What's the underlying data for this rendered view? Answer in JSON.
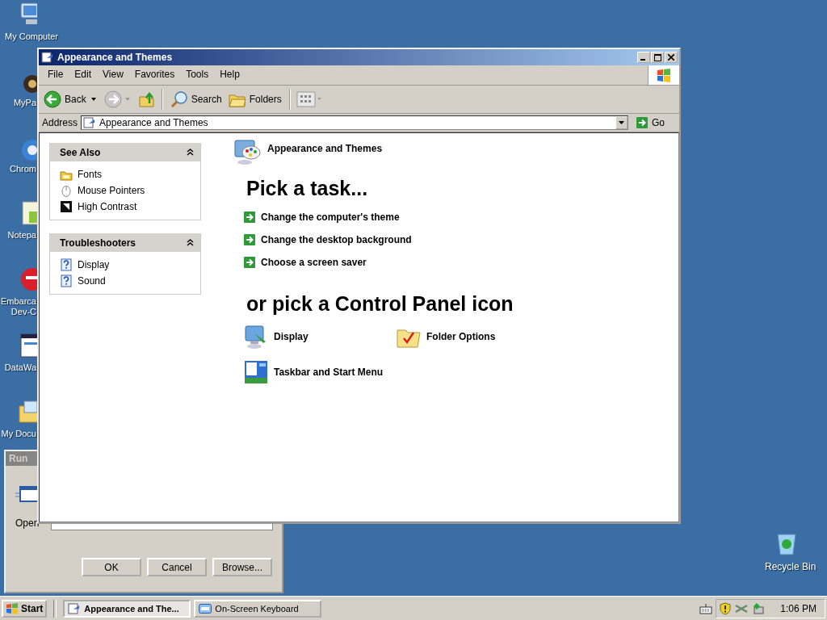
{
  "desktop_icons": [
    {
      "kind": "computer",
      "lines": [
        "My Computer"
      ]
    },
    {
      "kind": "app",
      "lines": [
        "MyPa"
      ]
    },
    {
      "kind": "browser",
      "lines": [
        "Chrom"
      ]
    },
    {
      "kind": "notepad",
      "lines": [
        "Notepa"
      ]
    },
    {
      "kind": "dev",
      "lines": [
        "Embarca",
        "Dev-C"
      ]
    },
    {
      "kind": "window",
      "lines": [
        "DataWa"
      ]
    },
    {
      "kind": "documents",
      "lines": [
        "My Docu"
      ]
    }
  ],
  "recycle_bin": {
    "label": "Recycle Bin"
  },
  "run_dialog": {
    "title": "Run",
    "open_label": "Open",
    "buttons": [
      "OK",
      "Cancel",
      "Browse..."
    ]
  },
  "window": {
    "title": "Appearance and Themes",
    "menu": [
      "File",
      "Edit",
      "View",
      "Favorites",
      "Tools",
      "Help"
    ],
    "toolbar": {
      "back": "Back",
      "search": "Search",
      "folders": "Folders"
    },
    "address": {
      "label": "Address",
      "value": "Appearance and Themes",
      "go": "Go"
    },
    "sidebar": [
      {
        "title": "See Also",
        "expanded": true,
        "items": [
          {
            "label": "Fonts",
            "kind": "fonts"
          },
          {
            "label": "Mouse Pointers",
            "kind": "mouse"
          },
          {
            "label": "High Contrast",
            "kind": "contrast"
          }
        ]
      },
      {
        "title": "Troubleshooters",
        "expanded": true,
        "items": [
          {
            "label": "Display",
            "kind": "help"
          },
          {
            "label": "Sound",
            "kind": "help"
          }
        ]
      }
    ],
    "header": "Appearance and Themes",
    "task_heading": "Pick a task...",
    "tasks": [
      "Change the computer's theme",
      "Change the desktop background",
      "Choose a screen saver"
    ],
    "icon_heading": "or pick a Control Panel icon",
    "icons": [
      {
        "label": "Display",
        "kind": "display"
      },
      {
        "label": "Folder Options",
        "kind": "folder-options"
      },
      {
        "label": "Taskbar and Start Menu",
        "kind": "taskbar"
      }
    ]
  },
  "taskbar": {
    "start": "Start",
    "buttons": [
      {
        "label": "Appearance and The...",
        "selected": true,
        "kind": "explorer"
      },
      {
        "label": "On-Screen Keyboard",
        "selected": false,
        "kind": "keyboard"
      }
    ],
    "clock": "1:06 PM"
  }
}
